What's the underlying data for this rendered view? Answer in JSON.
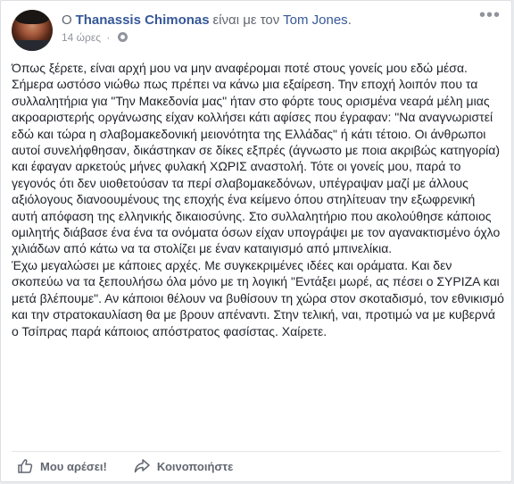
{
  "post": {
    "prefix": "Ο",
    "author": "Thanassis Chimonas",
    "with_text": "είναι με τον",
    "tagged": "Tom Jones",
    "tagged_suffix": ".",
    "time": "14 ώρες",
    "separator": "·",
    "privacy_icon": "globe-icon",
    "more_icon": "•••",
    "paragraphs": [
      "Όπως ξέρετε, είναι αρχή μου να μην αναφέρομαι ποτέ στους γονείς μου εδώ μέσα. Σήμερα ωστόσο νιώθω πως πρέπει να κάνω μια εξαίρεση. Την εποχή λοιπόν που τα συλλαλητήρια για \"Την Μακεδονία μας\" ήταν στο φόρτε τους ορισμένα νεαρά μέλη μιας ακροαριστερής οργάνωσης είχαν κολλήσει κάτι αφίσες που έγραφαν: \"Να αναγνωριστεί εδώ και τώρα η σλαβομακεδονική μειονότητα της Ελλάδας\" ή κάτι τέτοιο. Οι άνθρωποι αυτοί συνελήφθησαν, δικάστηκαν σε δίκες εξπρές (άγνωστο με ποια ακριβώς κατηγορία) και έφαγαν αρκετούς μήνες φυλακή ΧΩΡΙΣ αναστολή. Τότε οι γονείς μου, παρά το γεγονός ότι δεν υιοθετούσαν τα περί σλαβομακεδόνων, υπέγραψαν μαζί με άλλους αξιόλογους διανοουμένους της εποχής ένα κείμενο όπου στηλίτευαν την εξωφρενική αυτή απόφαση της ελληνικής δικαιοσύνης. Στο συλλαλητήριο που ακολούθησε κάποιος ομιλητής διάβασε ένα ένα τα ονόματα όσων είχαν υπογράψει με τον αγανακτισμένο όχλο χιλιάδων από κάτω να τα στολίζει με έναν καταιγισμό από μπινελίκια.",
      "Έχω μεγαλώσει με κάποιες αρχές. Με συγκεκριμένες ιδέες και οράματα. Και δεν σκοπεύω να τα ξεπουλήσω όλα μόνο με τη λογική \"Εντάξει μωρέ, ας πέσει ο ΣΥΡΙΖΑ και μετά βλέπουμε\". Αν κάποιοι θέλουν να βυθίσουν τη χώρα στον σκοταδισμό, τον εθνικισμό και την στρατοκαυλίαση θα με βρουν απέναντι. Στην τελική, ναι, προτιμώ να με κυβερνά ο Τσίπρας παρά κάποιος απόστρατος φασίστας. Χαίρετε."
    ]
  },
  "actions": {
    "like_label": "Μου αρέσει!",
    "share_label": "Κοινοποιήστε",
    "like_icon": "thumbs-up-icon",
    "share_icon": "share-arrow-icon"
  },
  "colors": {
    "link": "#365899",
    "text": "#1d2129",
    "muted": "#90949c",
    "action": "#616770"
  }
}
